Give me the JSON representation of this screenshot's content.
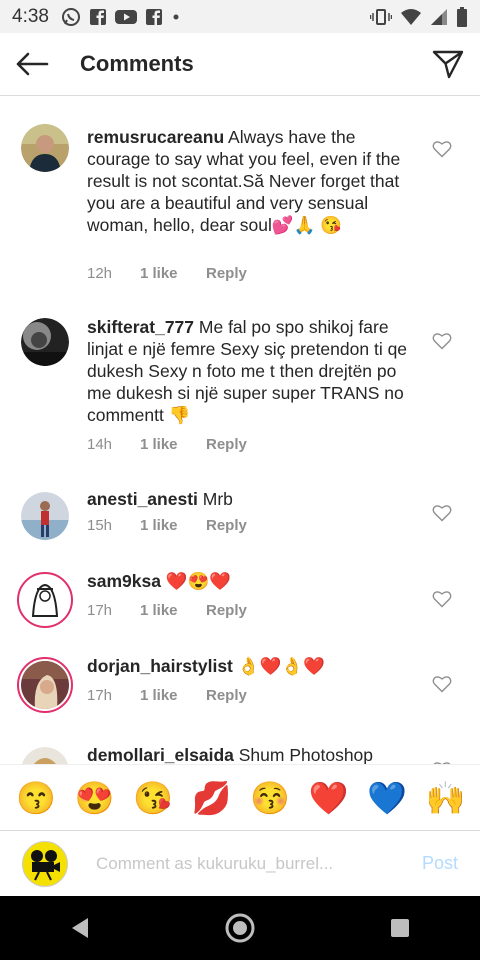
{
  "status_bar": {
    "time": "4:38",
    "left_icons": [
      "whatsapp-icon",
      "facebook-icon",
      "youtube-icon",
      "facebook-icon",
      "dot-icon"
    ],
    "right_icons": [
      "vibrate-icon",
      "wifi-icon",
      "signal-icon",
      "battery-icon"
    ]
  },
  "header": {
    "title": "Comments"
  },
  "comments": [
    {
      "username": "remusrucareanu",
      "text": " Always have the courage to say what you feel, even if the result is not scontat.Să Never forget that you are a beautiful and very sensual woman, hello, dear soul💕🙏 😘",
      "time": "12h",
      "likes": "1 like",
      "reply": "Reply"
    },
    {
      "username": "skifterat_777",
      "text": " Me fal po spo shikoj fare linjat e një femre Sexy siç pretendon ti qe dukesh Sexy n foto me t then drejtën po me dukesh si një super super TRANS no commentt 👎",
      "time": "14h",
      "likes": "1 like",
      "reply": "Reply"
    },
    {
      "username": "anesti_anesti",
      "text": " Mrb",
      "time": "15h",
      "likes": "1 like",
      "reply": "Reply"
    },
    {
      "username": "sam9ksa",
      "text": " ❤️😍❤️",
      "time": "17h",
      "likes": "1 like",
      "reply": "Reply"
    },
    {
      "username": "dorjan_hairstylist",
      "text": " 👌❤️👌❤️",
      "time": "17h",
      "likes": "1 like",
      "reply": "Reply"
    },
    {
      "username": "demollari_elsaida",
      "text": " Shum Photoshop",
      "time": "",
      "likes": "",
      "reply": ""
    }
  ],
  "emoji_bar": [
    "😙",
    "😍",
    "😘",
    "💋",
    "😚",
    "❤️",
    "💙",
    "🙌"
  ],
  "comment_bar": {
    "placeholder": "Comment as kukuruku_burrel...",
    "post_label": "Post"
  },
  "nav_bar": [
    "back-icon",
    "home-icon",
    "recents-icon"
  ]
}
